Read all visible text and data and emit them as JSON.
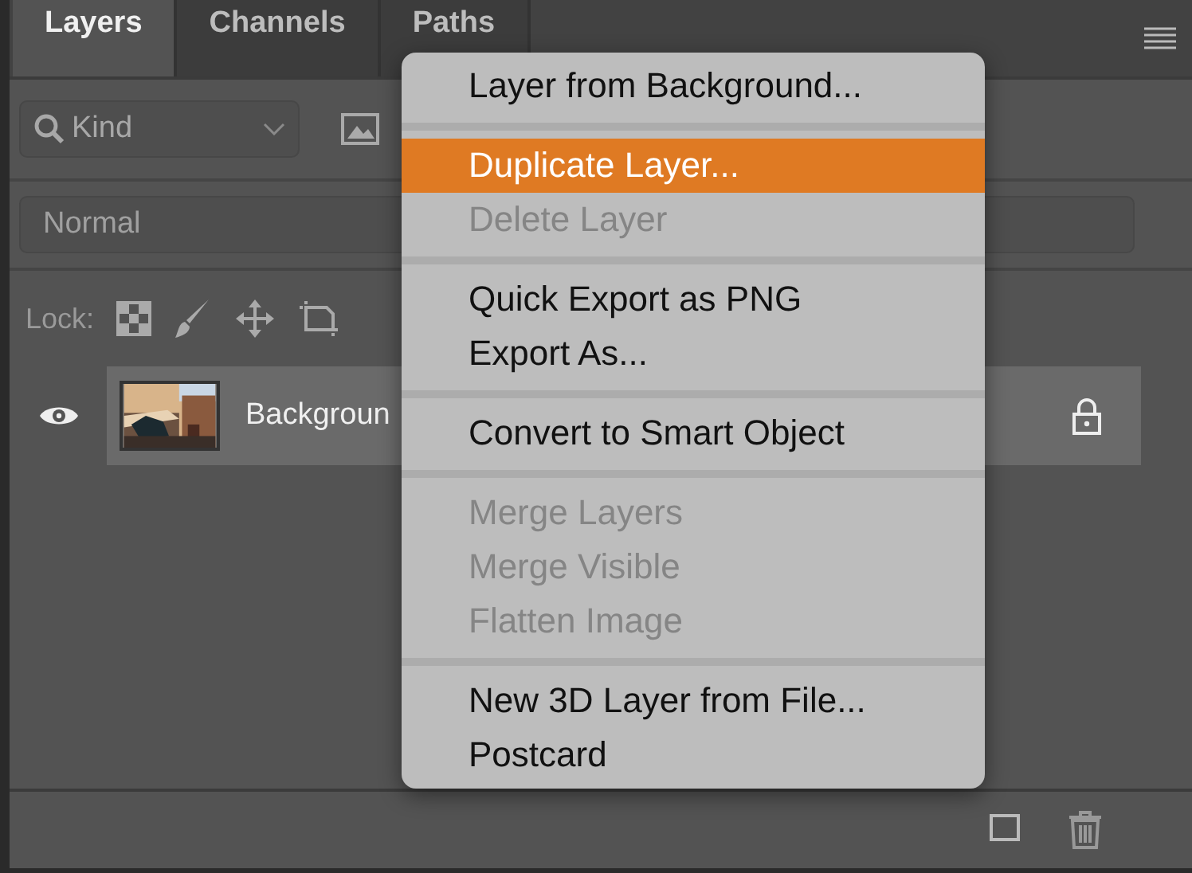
{
  "tabs": [
    {
      "label": "Layers",
      "selected": true
    },
    {
      "label": "Channels",
      "selected": false
    },
    {
      "label": "Paths",
      "selected": false
    }
  ],
  "filter": {
    "value": "Kind"
  },
  "blend_mode": {
    "value": "Normal"
  },
  "lock": {
    "label": "Lock:"
  },
  "layers": [
    {
      "name": "Backgroun",
      "visible": true,
      "locked": true,
      "selected": true,
      "kind": "picture"
    }
  ],
  "context_menu": [
    {
      "kind": "item",
      "label": "Layer from Background...",
      "disabled": false,
      "selected": false
    },
    {
      "kind": "separator"
    },
    {
      "kind": "item",
      "label": "Duplicate Layer...",
      "disabled": false,
      "selected": true
    },
    {
      "kind": "item",
      "label": "Delete Layer",
      "disabled": true,
      "selected": false
    },
    {
      "kind": "separator"
    },
    {
      "kind": "item",
      "label": "Quick Export as PNG",
      "disabled": false,
      "selected": false
    },
    {
      "kind": "item",
      "label": "Export As...",
      "disabled": false,
      "selected": false
    },
    {
      "kind": "separator"
    },
    {
      "kind": "item",
      "label": "Convert to Smart Object",
      "disabled": false,
      "selected": false
    },
    {
      "kind": "separator"
    },
    {
      "kind": "item",
      "label": "Merge Layers",
      "disabled": true,
      "selected": false
    },
    {
      "kind": "item",
      "label": "Merge Visible",
      "disabled": true,
      "selected": false
    },
    {
      "kind": "item",
      "label": "Flatten Image",
      "disabled": true,
      "selected": false
    },
    {
      "kind": "separator"
    },
    {
      "kind": "item",
      "label": "New 3D Layer from File...",
      "disabled": false,
      "selected": false
    },
    {
      "kind": "item",
      "label": "Postcard",
      "disabled": false,
      "selected": false
    }
  ]
}
